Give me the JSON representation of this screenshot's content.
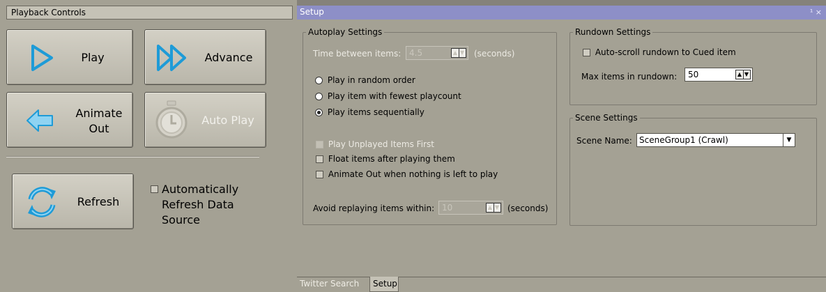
{
  "playback": {
    "header": "Playback Controls",
    "buttons": {
      "play": "Play",
      "advance": "Advance",
      "animate_out_line1": "Animate",
      "animate_out_line2": "Out",
      "auto_play": "Auto Play",
      "refresh": "Refresh"
    },
    "auto_refresh": {
      "line1": "Automatically",
      "line2": "Refresh Data",
      "line3": "Source",
      "checked": false
    }
  },
  "setup": {
    "title": "Setup",
    "title_icons": "¹ ×",
    "autoplay": {
      "legend": "Autoplay Settings",
      "time_between_label": "Time between items:",
      "time_between_value": "4.5",
      "time_between_unit": "(seconds)",
      "radios": [
        {
          "label": "Play in random order",
          "checked": false
        },
        {
          "label": "Play item with fewest playcount",
          "checked": false
        },
        {
          "label": "Play items sequentially",
          "checked": true
        }
      ],
      "checkboxes": [
        {
          "label": "Play Unplayed Items First",
          "checked": false,
          "disabled": true
        },
        {
          "label": "Float items after playing them",
          "checked": false,
          "disabled": false
        },
        {
          "label": "Animate Out when nothing is left to play",
          "checked": false,
          "disabled": false
        }
      ],
      "avoid_label": "Avoid replaying items within:",
      "avoid_value": "10",
      "avoid_unit": "(seconds)"
    },
    "rundown": {
      "legend": "Rundown Settings",
      "auto_scroll_label": "Auto-scroll rundown to Cued item",
      "auto_scroll_checked": false,
      "max_items_label": "Max items in rundown:",
      "max_items_value": "50"
    },
    "scene": {
      "legend": "Scene Settings",
      "scene_name_label": "Scene Name:",
      "scene_name_value": "SceneGroup1 (Crawl)"
    }
  },
  "tabs": [
    {
      "label": "Twitter Search",
      "active": false
    },
    {
      "label": "Setup",
      "active": true
    }
  ],
  "colors": {
    "panel_bg": "#a4a194",
    "title_bar": "#8d8fc7",
    "icon_blue": "#1e9bd7"
  }
}
